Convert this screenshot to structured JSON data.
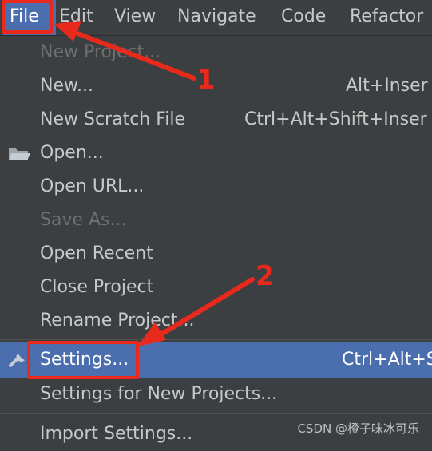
{
  "menubar": {
    "items": [
      {
        "label": "File"
      },
      {
        "label": "Edit"
      },
      {
        "label": "View"
      },
      {
        "label": "Navigate"
      },
      {
        "label": "Code"
      },
      {
        "label": "Refactor"
      }
    ]
  },
  "file_menu": {
    "items": [
      {
        "label": "New Project...",
        "shortcut": "",
        "disabled": true
      },
      {
        "label": "New...",
        "shortcut": "Alt+Inser"
      },
      {
        "label": "New Scratch File",
        "shortcut": "Ctrl+Alt+Shift+Inser"
      },
      {
        "label": "Open...",
        "shortcut": "",
        "icon": "folder-icon"
      },
      {
        "label": "Open URL...",
        "shortcut": ""
      },
      {
        "label": "Save As...",
        "shortcut": "",
        "disabled": true
      },
      {
        "label": "Open Recent",
        "shortcut": ""
      },
      {
        "label": "Close Project",
        "shortcut": ""
      },
      {
        "label": "Rename Project...",
        "shortcut": ""
      },
      {
        "label": "Settings...",
        "shortcut": "Ctrl+Alt+S",
        "icon": "wrench-icon",
        "selected": true
      },
      {
        "label": "Settings for New Projects...",
        "shortcut": ""
      },
      {
        "label": "Import Settings...",
        "shortcut": ""
      }
    ]
  },
  "annotations": {
    "step1": "1",
    "step2": "2",
    "color": "#e8291c"
  },
  "watermark": "CSDN @橙子味冰可乐",
  "colors": {
    "menu_bg": "#3c3f41",
    "selection": "#4b6eaf",
    "text": "#c8c8c8",
    "disabled_text": "#6f6f6f"
  }
}
